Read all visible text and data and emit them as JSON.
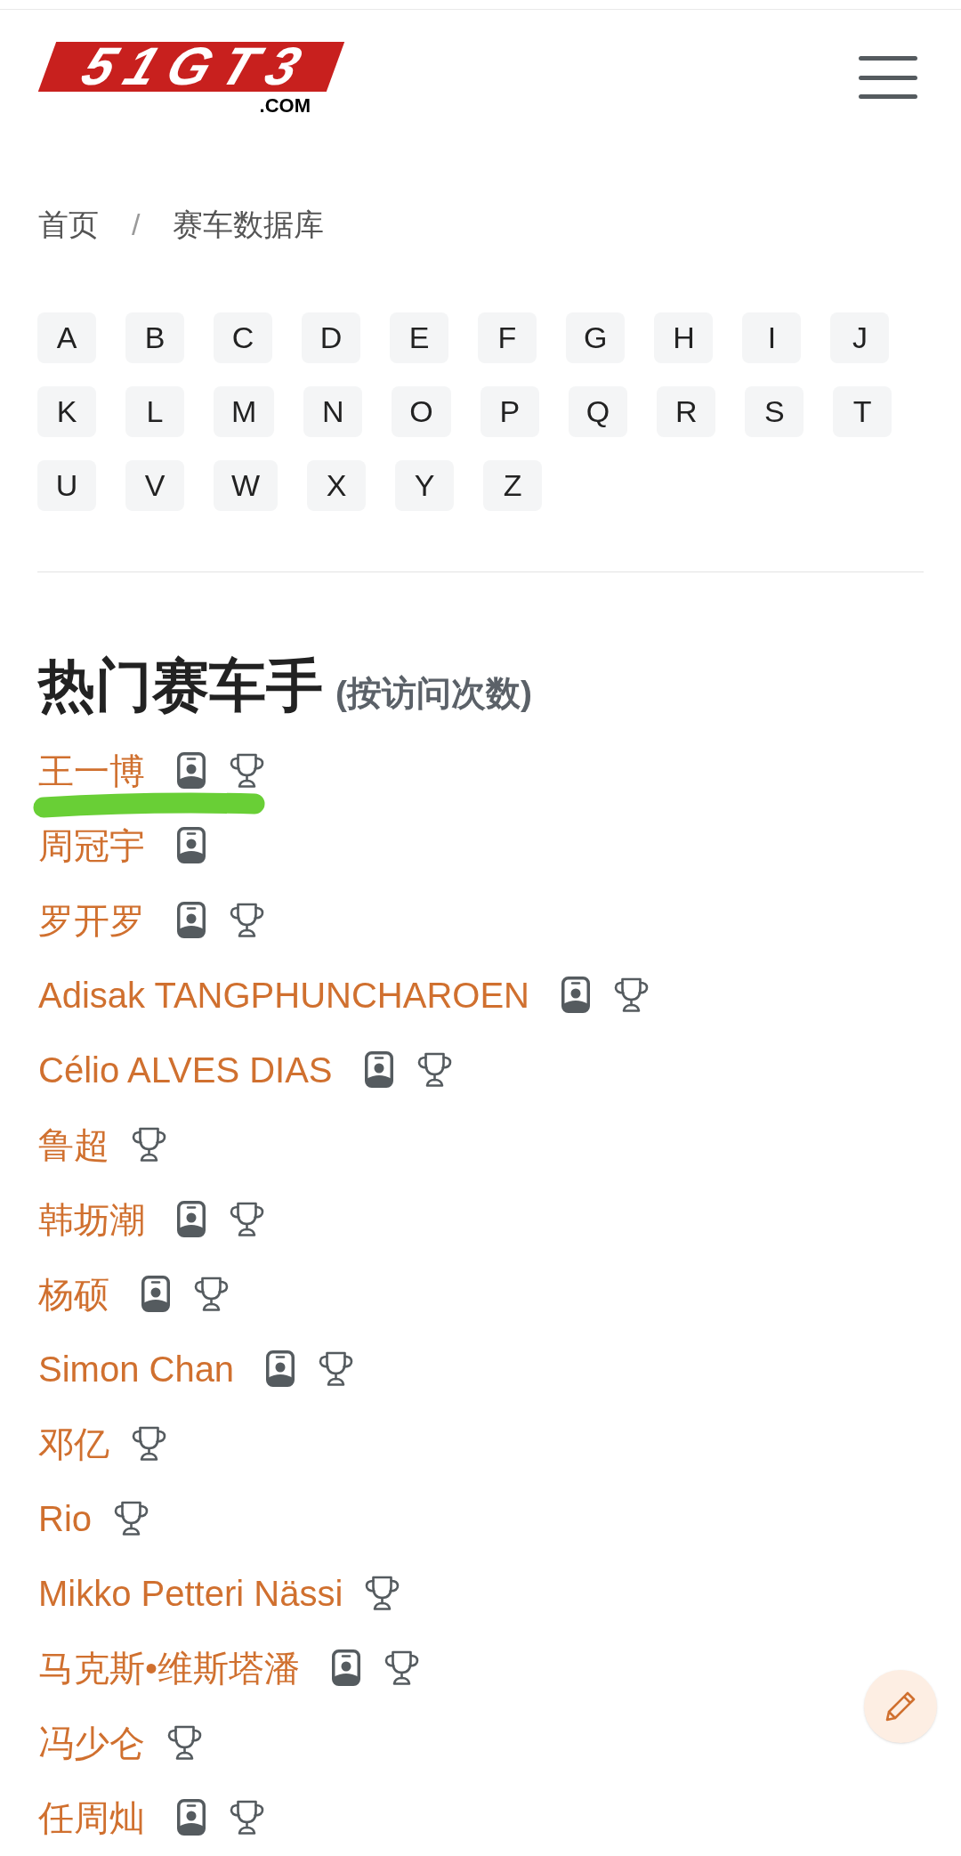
{
  "header": {
    "logo": {
      "wordmark": "51GT3",
      "domain": ".COM"
    }
  },
  "breadcrumb": {
    "items": [
      "首页",
      "赛车数据库"
    ],
    "separator": "/"
  },
  "alphabet": [
    "A",
    "B",
    "C",
    "D",
    "E",
    "F",
    "G",
    "H",
    "I",
    "J",
    "K",
    "L",
    "M",
    "N",
    "O",
    "P",
    "Q",
    "R",
    "S",
    "T",
    "U",
    "V",
    "W",
    "X",
    "Y",
    "Z"
  ],
  "heading": {
    "title": "热门赛车手",
    "note": "(按访问次数)"
  },
  "drivers": [
    {
      "name": "王一博",
      "has_profile": true,
      "has_trophy": true,
      "highlighted": true
    },
    {
      "name": "周冠宇",
      "has_profile": true,
      "has_trophy": false,
      "highlighted": false
    },
    {
      "name": "罗开罗",
      "has_profile": true,
      "has_trophy": true,
      "highlighted": false
    },
    {
      "name": "Adisak TANGPHUNCHAROEN",
      "has_profile": true,
      "has_trophy": true,
      "highlighted": false
    },
    {
      "name": "Célio ALVES DIAS",
      "has_profile": true,
      "has_trophy": true,
      "highlighted": false
    },
    {
      "name": "鲁超",
      "has_profile": false,
      "has_trophy": true,
      "highlighted": false
    },
    {
      "name": "韩坜潮",
      "has_profile": true,
      "has_trophy": true,
      "highlighted": false
    },
    {
      "name": "杨硕",
      "has_profile": true,
      "has_trophy": true,
      "highlighted": false
    },
    {
      "name": "Simon Chan",
      "has_profile": true,
      "has_trophy": true,
      "highlighted": false
    },
    {
      "name": "邓亿",
      "has_profile": false,
      "has_trophy": true,
      "highlighted": false
    },
    {
      "name": "Rio",
      "has_profile": false,
      "has_trophy": true,
      "highlighted": false
    },
    {
      "name": "Mikko Petteri Nässi",
      "has_profile": false,
      "has_trophy": true,
      "highlighted": false
    },
    {
      "name": "马克斯•维斯塔潘",
      "has_profile": true,
      "has_trophy": true,
      "highlighted": false
    },
    {
      "name": "冯少仑",
      "has_profile": false,
      "has_trophy": true,
      "highlighted": false
    },
    {
      "name": "任周灿",
      "has_profile": true,
      "has_trophy": true,
      "highlighted": false
    }
  ]
}
